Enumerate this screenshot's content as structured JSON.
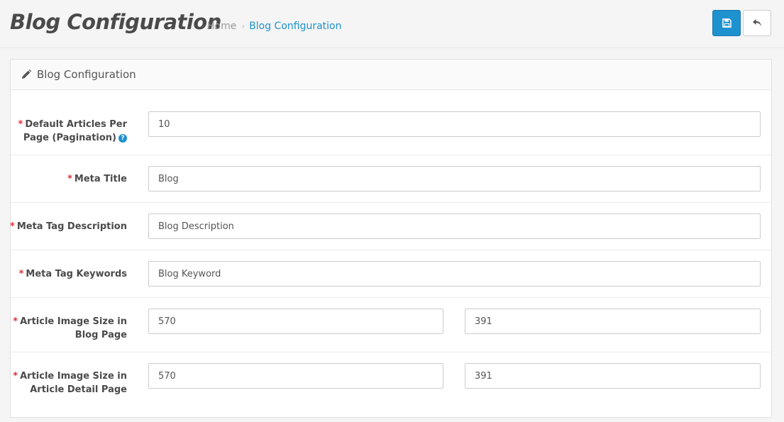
{
  "header": {
    "title": "Blog Configuration",
    "breadcrumb": {
      "home": "Home",
      "separator": "›",
      "current": "Blog Configuration"
    },
    "save_icon": "floppy-disk-icon",
    "back_icon": "reply-arrow-icon"
  },
  "panel": {
    "title": "Blog Configuration",
    "icon": "pencil-icon"
  },
  "form": {
    "required_marker": "*",
    "help_marker": "?",
    "fields": [
      {
        "label_line1": "Default Articles Per",
        "label_line2": "Page (Pagination)",
        "value": "10"
      },
      {
        "label": "Meta Title",
        "value": "Blog"
      },
      {
        "label": "Meta Tag Description",
        "value": "Blog Description"
      },
      {
        "label": "Meta Tag Keywords",
        "value": "Blog Keyword"
      },
      {
        "label_line1": "Article Image Size in",
        "label_line2": "Blog Page",
        "width": "570",
        "height": "391"
      },
      {
        "label_line1": "Article Image Size in",
        "label_line2": "Article Detail Page",
        "width": "570",
        "height": "391"
      }
    ]
  },
  "colors": {
    "primary": "#1e91cf",
    "required": "#e3303b"
  }
}
